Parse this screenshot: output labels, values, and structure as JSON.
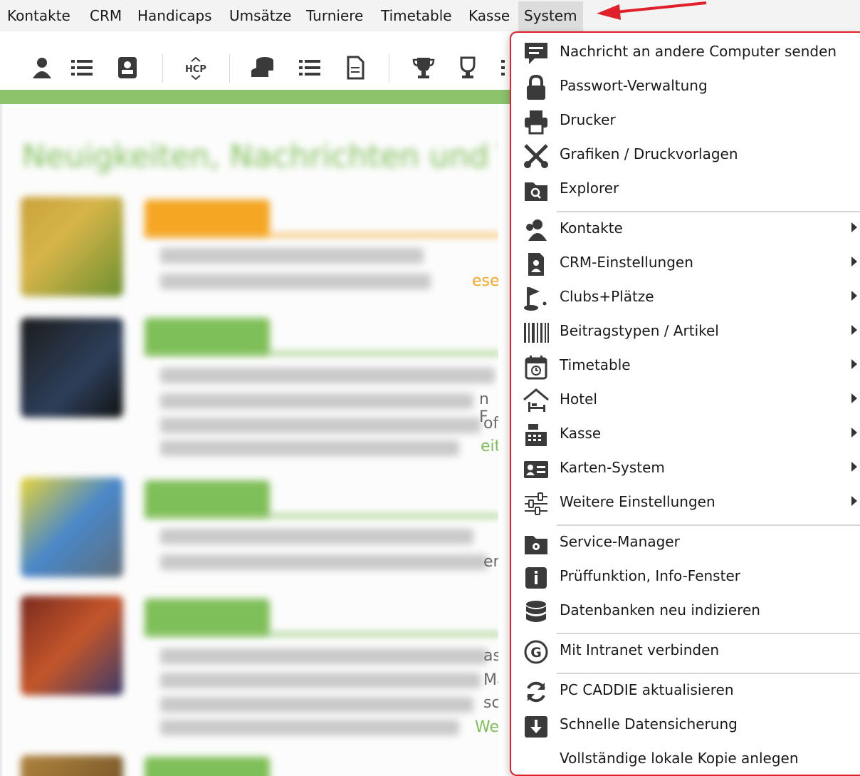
{
  "menubar": {
    "items": [
      "Kontakte",
      "CRM",
      "Handicaps",
      "Umsätze",
      "Turniere",
      "Timetable",
      "Kasse",
      "System"
    ],
    "active": "System"
  },
  "content": {
    "news_title": "Neuigkeiten, Nachrichten und T",
    "fragments": [
      "ese",
      "n F",
      "ofe",
      "eit",
      "en",
      "as",
      "Mä",
      "sc",
      "Wei"
    ]
  },
  "system_menu": {
    "items": [
      {
        "label": "Nachricht an andere Computer senden",
        "icon": "message-icon",
        "submenu": false
      },
      {
        "label": "Passwort-Verwaltung",
        "icon": "lock-icon",
        "submenu": false
      },
      {
        "label": "Drucker",
        "icon": "printer-icon",
        "submenu": false
      },
      {
        "label": "Grafiken / Druckvorlagen",
        "icon": "scissors-icon",
        "submenu": false
      },
      {
        "label": "Explorer",
        "icon": "folder-search-icon",
        "submenu": false
      },
      {
        "label": "Kontakte",
        "icon": "contacts-icon",
        "submenu": true
      },
      {
        "label": "CRM-Einstellungen",
        "icon": "crm-icon",
        "submenu": true
      },
      {
        "label": "Clubs+Plätze",
        "icon": "golf-flag-icon",
        "submenu": true
      },
      {
        "label": "Beitragstypen / Artikel",
        "icon": "barcode-icon",
        "submenu": true
      },
      {
        "label": "Timetable",
        "icon": "calendar-clock-icon",
        "submenu": true
      },
      {
        "label": "Hotel",
        "icon": "hotel-icon",
        "submenu": true
      },
      {
        "label": "Kasse",
        "icon": "cash-register-icon",
        "submenu": true
      },
      {
        "label": "Karten-System",
        "icon": "id-card-icon",
        "submenu": true
      },
      {
        "label": "Weitere Einstellungen",
        "icon": "sliders-icon",
        "submenu": true
      },
      {
        "label": "Service-Manager",
        "icon": "folder-gear-icon",
        "submenu": false
      },
      {
        "label": "Prüffunktion, Info-Fenster",
        "icon": "info-icon",
        "submenu": false
      },
      {
        "label": "Datenbanken neu indizieren",
        "icon": "database-icon",
        "submenu": false
      },
      {
        "label": "Mit Intranet verbinden",
        "icon": "intranet-g-icon",
        "submenu": false
      },
      {
        "label": "PC CADDIE aktualisieren",
        "icon": "refresh-icon",
        "submenu": false
      },
      {
        "label": "Schnelle Datensicherung",
        "icon": "download-icon",
        "submenu": false
      },
      {
        "label": "Vollständige lokale Kopie anlegen",
        "icon": "",
        "submenu": false
      }
    ]
  },
  "colors": {
    "highlight_red": "#e0202a",
    "accent_green": "#8cc36b",
    "accent_orange": "#f5a623",
    "menu_bg": "#f3f3f3"
  }
}
